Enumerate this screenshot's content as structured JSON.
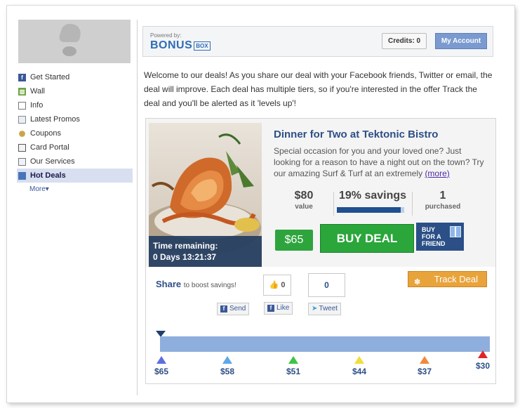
{
  "sidebar": {
    "items": [
      {
        "label": "Get Started",
        "icon": "facebook-icon"
      },
      {
        "label": "Wall",
        "icon": "wall-icon"
      },
      {
        "label": "Info",
        "icon": "info-icon"
      },
      {
        "label": "Latest Promos",
        "icon": "promo-icon"
      },
      {
        "label": "Coupons",
        "icon": "coupon-icon"
      },
      {
        "label": "Card Portal",
        "icon": "card-icon"
      },
      {
        "label": "Our Services",
        "icon": "services-icon"
      },
      {
        "label": "Hot Deals",
        "icon": "hot-deals-icon",
        "active": true
      }
    ],
    "more_label": "More▾"
  },
  "header": {
    "powered_by": "Powered by:",
    "logo_word": "BONUS",
    "logo_box": "BOX",
    "credits": "Credits: 0",
    "my_account": "My Account"
  },
  "welcome": "Welcome to our deals! As you share our deal with your Facebook friends, Twitter or email, the deal will improve. Each deal has multiple tiers, so if you're interested in the offer Track the deal and you'll be alerted as it 'levels up'!",
  "deal": {
    "title": "Dinner for Two at Tektonic Bistro",
    "description": "Special occasion for you and your loved one? Just looking for a reason to have a night out on the town? Try our amazing Surf & Turf at an extremely",
    "more_link": "(more)",
    "time_label": "Time remaining:",
    "time_value": "0 Days 13:21:37",
    "value": "$80",
    "value_label": "value",
    "savings": "19% savings",
    "savings_fraction": 0.19,
    "purchased": "1",
    "purchased_label": "purchased",
    "price": "$65",
    "buy_label": "BUY DEAL",
    "friend_lines": [
      "BUY",
      "FOR A",
      "FRIEND"
    ]
  },
  "share": {
    "title": "Share",
    "subtitle": "to boost savings!",
    "send_label": "Send",
    "like_count": "0",
    "like_label": "Like",
    "tweet_count": "0",
    "tweet_label": "Tweet",
    "track_label": "Track Deal"
  },
  "tiers": [
    {
      "price": "$65",
      "color": "#5b6fe0"
    },
    {
      "price": "$58",
      "color": "#5fa8e6"
    },
    {
      "price": "$51",
      "color": "#3ec447"
    },
    {
      "price": "$44",
      "color": "#f1de3a"
    },
    {
      "price": "$37",
      "color": "#f08a3c"
    },
    {
      "price": "$30",
      "color": "#e0252a"
    }
  ]
}
